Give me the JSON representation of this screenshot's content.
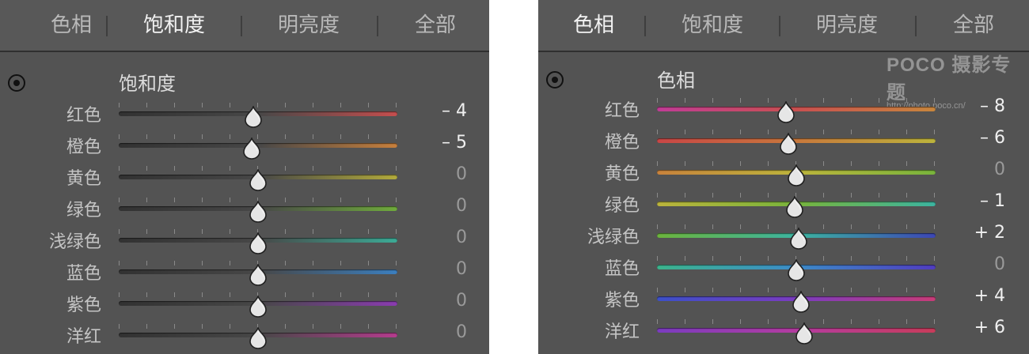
{
  "panels": [
    {
      "id": "left",
      "tabs": [
        {
          "label": "色相",
          "active": false
        },
        {
          "label": "饱和度",
          "active": true
        },
        {
          "label": "明亮度",
          "active": false
        },
        {
          "label": "全部",
          "active": false
        }
      ],
      "section_title": "饱和度",
      "target_icon": "target-icon",
      "rows": [
        {
          "label": "红色",
          "value": "– 4",
          "numeric": -4,
          "track_colors": [
            "#323232",
            "#474747",
            "#c54e4e"
          ]
        },
        {
          "label": "橙色",
          "value": "– 5",
          "numeric": -5,
          "track_colors": [
            "#323232",
            "#474747",
            "#c77f3c"
          ]
        },
        {
          "label": "黄色",
          "value": "0",
          "numeric": 0,
          "track_colors": [
            "#323232",
            "#474747",
            "#b3ab3c"
          ]
        },
        {
          "label": "绿色",
          "value": "0",
          "numeric": 0,
          "track_colors": [
            "#323232",
            "#474747",
            "#6fab3c"
          ]
        },
        {
          "label": "浅绿色",
          "value": "0",
          "numeric": 0,
          "track_colors": [
            "#323232",
            "#474747",
            "#3cab96"
          ]
        },
        {
          "label": "蓝色",
          "value": "0",
          "numeric": 0,
          "track_colors": [
            "#323232",
            "#474747",
            "#3c7fbf"
          ]
        },
        {
          "label": "紫色",
          "value": "0",
          "numeric": 0,
          "track_colors": [
            "#323232",
            "#474747",
            "#8a3cb0"
          ]
        },
        {
          "label": "洋红",
          "value": "0",
          "numeric": 0,
          "track_colors": [
            "#323232",
            "#474747",
            "#b53c8e"
          ]
        }
      ]
    },
    {
      "id": "right",
      "tabs": [
        {
          "label": "色相",
          "active": true
        },
        {
          "label": "饱和度",
          "active": false
        },
        {
          "label": "明亮度",
          "active": false
        },
        {
          "label": "全部",
          "active": false
        }
      ],
      "section_title": "色相",
      "target_icon": "target-icon",
      "rows": [
        {
          "label": "红色",
          "value": "– 8",
          "numeric": -8,
          "track_colors": [
            "#c13c96",
            "#c95050",
            "#c8863c"
          ]
        },
        {
          "label": "橙色",
          "value": "– 6",
          "numeric": -6,
          "track_colors": [
            "#c84646",
            "#c8783c",
            "#bcb43c"
          ]
        },
        {
          "label": "黄色",
          "value": "0",
          "numeric": 0,
          "track_colors": [
            "#c8823c",
            "#bcb43c",
            "#78b43c"
          ]
        },
        {
          "label": "绿色",
          "value": "– 1",
          "numeric": -1,
          "track_colors": [
            "#bcb43c",
            "#78b43c",
            "#3cb4a0"
          ]
        },
        {
          "label": "浅绿色",
          "value": "+ 2",
          "numeric": 2,
          "track_colors": [
            "#6cb43c",
            "#3cb4a0",
            "#3c46b4"
          ]
        },
        {
          "label": "蓝色",
          "value": "0",
          "numeric": 0,
          "track_colors": [
            "#3cb48c",
            "#3c8cc8",
            "#503cc0"
          ]
        },
        {
          "label": "紫色",
          "value": "+ 4",
          "numeric": 4,
          "track_colors": [
            "#3c50c8",
            "#7a3cc0",
            "#c83c78"
          ]
        },
        {
          "label": "洋红",
          "value": "+ 6",
          "numeric": 6,
          "track_colors": [
            "#7a3cc0",
            "#b43ca0",
            "#c83c5a"
          ]
        }
      ],
      "watermark": {
        "logo": "POCO 摄影专题",
        "url": "http://photo.poco.cn/"
      }
    }
  ]
}
